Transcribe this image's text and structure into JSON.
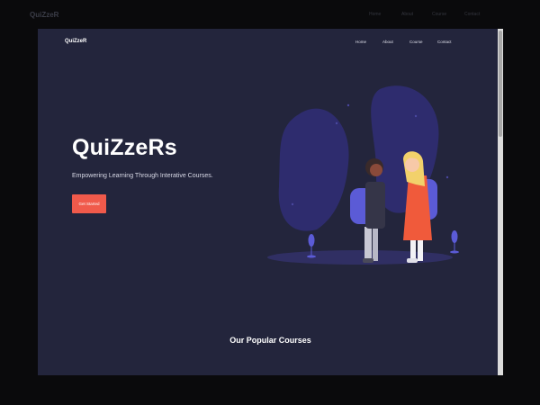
{
  "background_page": {
    "logo": "QuiZzeR",
    "nav": [
      "Home",
      "About",
      "Course",
      "Contact"
    ]
  },
  "header": {
    "logo": "QuiZzeR",
    "nav": [
      "Home",
      "About",
      "Course",
      "Contact"
    ]
  },
  "hero": {
    "title": "QuiZzeRs",
    "subtitle": "Empowering Learning Through Interative Courses.",
    "cta_label": "Get Started"
  },
  "courses": {
    "title": "Our Popular Courses"
  },
  "colors": {
    "page_bg": "#0a0a0c",
    "panel_bg": "#23253c",
    "accent": "#f05a4b",
    "illustration_purple": "#3d3a8c",
    "illustration_blue": "#5b5bd6"
  },
  "icons": {
    "illustration": "students-with-backpacks-illustration"
  }
}
